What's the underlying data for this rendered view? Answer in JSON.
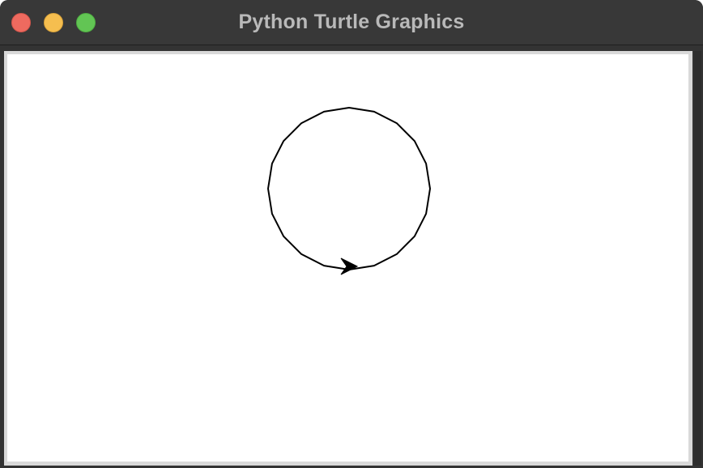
{
  "window": {
    "title": "Python Turtle Graphics",
    "controls": {
      "close": "close",
      "minimize": "minimize",
      "zoom": "zoom"
    }
  },
  "canvas": {
    "background": "#ffffff",
    "pen_color": "#000000",
    "drawing": "circle",
    "turtle_shape": "arrow",
    "turtle_heading": "east"
  },
  "colors": {
    "titlebar": "#383838",
    "title_text": "#b9b9b9",
    "close": "#ee6a5f",
    "minimize": "#f5be4f",
    "zoom": "#62c554"
  }
}
